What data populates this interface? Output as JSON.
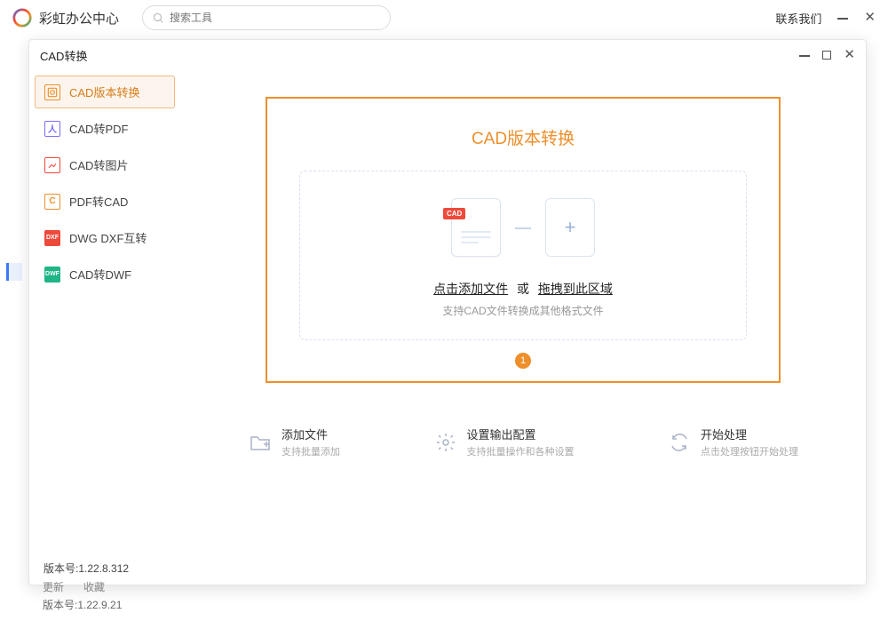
{
  "header": {
    "app_title": "彩虹办公中心",
    "search_placeholder": "搜索工具",
    "contact": "联系我们"
  },
  "dialog": {
    "title": "CAD转换"
  },
  "sidebar": {
    "items": [
      {
        "label": "CAD版本转换",
        "icon_color": "#ee8f2b"
      },
      {
        "label": "CAD转PDF",
        "icon_color": "#7a6cff"
      },
      {
        "label": "CAD转图片",
        "icon_color": "#ee4a3c"
      },
      {
        "label": "PDF转CAD",
        "icon_color": "#ee8f2b"
      },
      {
        "label": "DWG DXF互转",
        "icon_color": "#ee4a3c"
      },
      {
        "label": "CAD转DWF",
        "icon_color": "#1fb586"
      }
    ]
  },
  "panel": {
    "heading": "CAD版本转换",
    "file_badge": "CAD",
    "dz_click": "点击添加文件",
    "dz_or": "或",
    "dz_drag": "拖拽到此区域",
    "dz_sub": "支持CAD文件转换成其他格式文件",
    "step": "1"
  },
  "actions": [
    {
      "title": "添加文件",
      "sub": "支持批量添加",
      "icon": "add-file-icon"
    },
    {
      "title": "设置输出配置",
      "sub": "支持批量操作和各种设置",
      "icon": "gear-icon"
    },
    {
      "title": "开始处理",
      "sub": "点击处理按钮开始处理",
      "icon": "refresh-icon"
    }
  ],
  "footer": {
    "version_inside": "版本号:1.22.8.312",
    "tab_update": "更新",
    "tab_favorite": "收藏",
    "version_outside": "版本号:1.22.9.21"
  }
}
